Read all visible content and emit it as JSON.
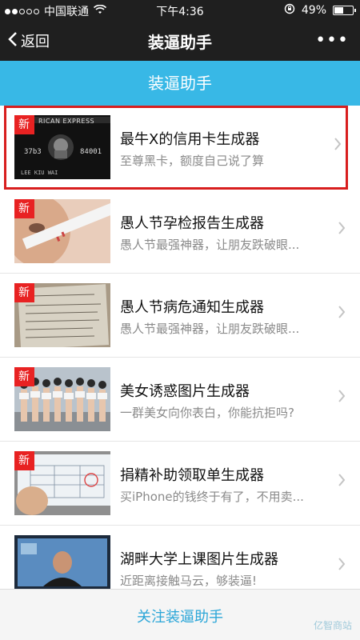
{
  "status": {
    "carrier": "中国联通",
    "time": "下午4:36",
    "battery": "49%",
    "battery_level": 0.49
  },
  "nav": {
    "back_label": "返回",
    "title": "装逼助手",
    "more_label": "•••"
  },
  "banner": {
    "title": "装逼助手"
  },
  "items": [
    {
      "badge": "新",
      "title": "最牛X的信用卡生成器",
      "subtitle": "至尊黑卡，额度自己说了算",
      "thumb_text": "RICAN EXPRESS"
    },
    {
      "badge": "新",
      "title": "愚人节孕检报告生成器",
      "subtitle": "愚人节最强神器，让朋友跌破眼..."
    },
    {
      "badge": "新",
      "title": "愚人节病危通知生成器",
      "subtitle": "愚人节最强神器，让朋友跌破眼..."
    },
    {
      "badge": "新",
      "title": "美女诱惑图片生成器",
      "subtitle": "一群美女向你表白，你能抗拒吗?"
    },
    {
      "badge": "新",
      "title": "捐精补助领取单生成器",
      "subtitle": "买iPhone的钱终于有了，不用卖..."
    },
    {
      "title": "湖畔大学上课图片生成器",
      "subtitle": "近距离接触马云，够装逼!"
    }
  ],
  "footer": {
    "follow_label": "关注装逼助手",
    "watermark": "亿智商站"
  }
}
